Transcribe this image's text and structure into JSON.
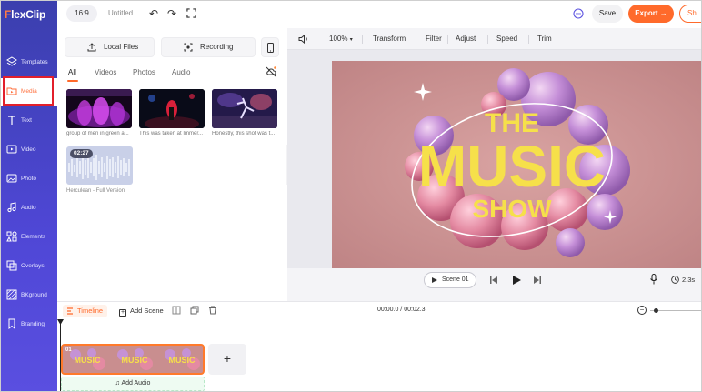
{
  "app": {
    "logo_prefix": "F",
    "logo_rest": "lexClip"
  },
  "topbar": {
    "ratio": "16:9",
    "title": "Untitled",
    "save_label": "Save",
    "export_label": "Export →",
    "share_label": "Sh"
  },
  "sidebar": {
    "items": [
      {
        "label": "Templates",
        "icon": "layers-icon"
      },
      {
        "label": "Media",
        "icon": "folder-icon"
      },
      {
        "label": "Text",
        "icon": "text-icon"
      },
      {
        "label": "Video",
        "icon": "video-icon"
      },
      {
        "label": "Photo",
        "icon": "photo-icon"
      },
      {
        "label": "Audio",
        "icon": "music-icon"
      },
      {
        "label": "Elements",
        "icon": "elements-icon"
      },
      {
        "label": "Overlays",
        "icon": "overlays-icon"
      },
      {
        "label": "BKground",
        "icon": "background-icon"
      },
      {
        "label": "Branding",
        "icon": "branding-icon"
      }
    ],
    "active": "Media"
  },
  "media_panel": {
    "local_files_label": "Local Files",
    "recording_label": "Recording",
    "tabs": [
      "All",
      "Videos",
      "Photos",
      "Audio"
    ],
    "active_tab": "All",
    "items": [
      {
        "caption": "group of men in green a..."
      },
      {
        "caption": "This was taken at Immer..."
      },
      {
        "caption": "Honestly, this shot was t..."
      }
    ],
    "audio": {
      "duration": "02:27",
      "caption": "Herculean - Full Version"
    }
  },
  "preview": {
    "zoom": "100%",
    "tools": [
      "Transform",
      "Filter",
      "Adjust",
      "Speed",
      "Trim"
    ],
    "canvas_text": {
      "line1": "THE",
      "line2": "MUSIC",
      "line3": "SHOW"
    },
    "scene_label": "Scene 01",
    "duration": "2.3s"
  },
  "timeline": {
    "timeline_label": "Timeline",
    "add_scene_label": "Add Scene",
    "time": "00:00.0 / 00:02.3",
    "clip_number": "01",
    "thumb_text": "MUSIC",
    "add_clip_label": "+",
    "add_audio_label": "Add Audio"
  },
  "colors": {
    "accent": "#ff6a2b",
    "sidebar": "#4f47d6",
    "highlight": "#e21f2b",
    "canvas_bg": "#c98e8f",
    "title_yellow": "#f7e64a"
  }
}
